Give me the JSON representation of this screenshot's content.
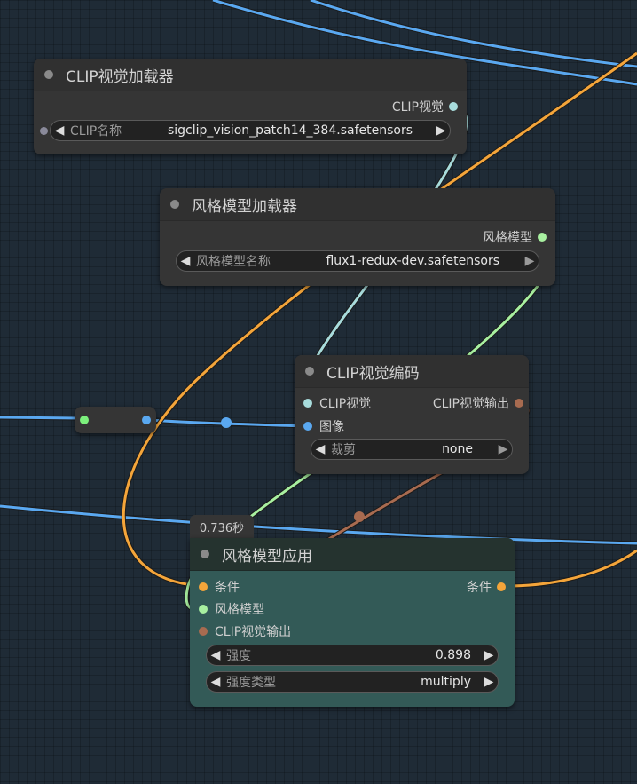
{
  "colors": {
    "background": "#1f2b36",
    "wire_blue": "#5aa8f0",
    "wire_orange": "#f4a53a",
    "wire_green": "#a8f0a0",
    "wire_teal": "#a8dcdc",
    "wire_brown": "#a86b50",
    "apply_node_bg": "#335a57",
    "apply_node_title_bg": "#25332f"
  },
  "nodes": {
    "clip_loader": {
      "title": "CLIP视觉加载器",
      "output_label": "CLIP视觉",
      "widget_label": "CLIP名称",
      "widget_value": "sigclip_vision_patch14_384.safetensors"
    },
    "style_loader": {
      "title": "风格模型加载器",
      "output_label": "风格模型",
      "widget_label": "风格模型名称",
      "widget_value": "flux1-redux-dev.safetensors"
    },
    "clip_encode": {
      "title": "CLIP视觉编码",
      "input_clip": "CLIP视觉",
      "input_image": "图像",
      "output_label": "CLIP视觉输出",
      "widget_label": "裁剪",
      "widget_value": "none"
    },
    "style_apply": {
      "badge": "0.736秒",
      "title": "风格模型应用",
      "input_condition": "条件",
      "input_style": "风格模型",
      "input_clip_output": "CLIP视觉输出",
      "output_label": "条件",
      "strength_label": "强度",
      "strength_value": "0.898",
      "type_label": "强度类型",
      "type_value": "multiply"
    }
  },
  "icons": {
    "left_arrow": "◀",
    "right_arrow": "▶"
  }
}
